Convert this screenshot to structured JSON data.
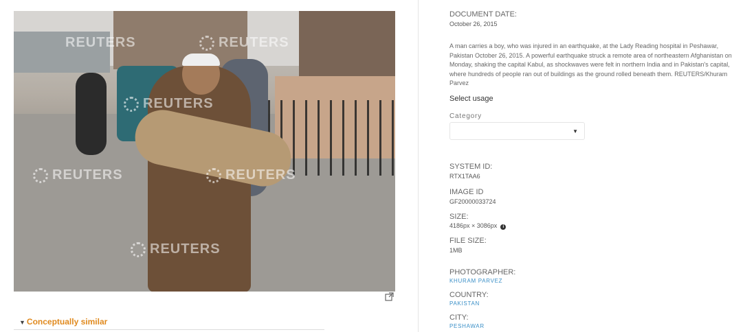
{
  "photo": {
    "watermark": "REUTERS",
    "open_icon": "external-link-icon"
  },
  "similar": {
    "label": "Conceptually similar",
    "toggle_icon": "triangle-down-icon"
  },
  "details": {
    "document_date_label": "DOCUMENT DATE:",
    "document_date": "October 26, 2015",
    "caption": "A man carries a boy, who was injured in an earthquake, at the Lady Reading hospital in Peshawar, Pakistan October 26, 2015. A powerful earthquake struck a remote area of northeastern Afghanistan on Monday, shaking the capital Kabul, as shockwaves were felt in northern India and in Pakistan's capital, where hundreds of people ran out of buildings as the ground rolled beneath them. REUTERS/Khuram Parvez",
    "select_usage": "Select usage",
    "category_label": "Category",
    "category_value": "",
    "system_id_label": "SYSTEM ID:",
    "system_id": "RTX1TAA6",
    "image_id_label": "IMAGE ID",
    "image_id": "GF20000033724",
    "size_label": "SIZE:",
    "size": "4186px × 3086px",
    "file_size_label": "FILE SIZE:",
    "file_size": "1MB",
    "photographer_label": "PHOTOGRAPHER:",
    "photographer": "KHURAM PARVEZ",
    "country_label": "COUNTRY:",
    "country": "PAKISTAN",
    "city_label": "CITY:",
    "city": "PESHAWAR"
  },
  "colors": {
    "accent_orange": "#e0891d",
    "link_blue": "#3a8fc7"
  }
}
